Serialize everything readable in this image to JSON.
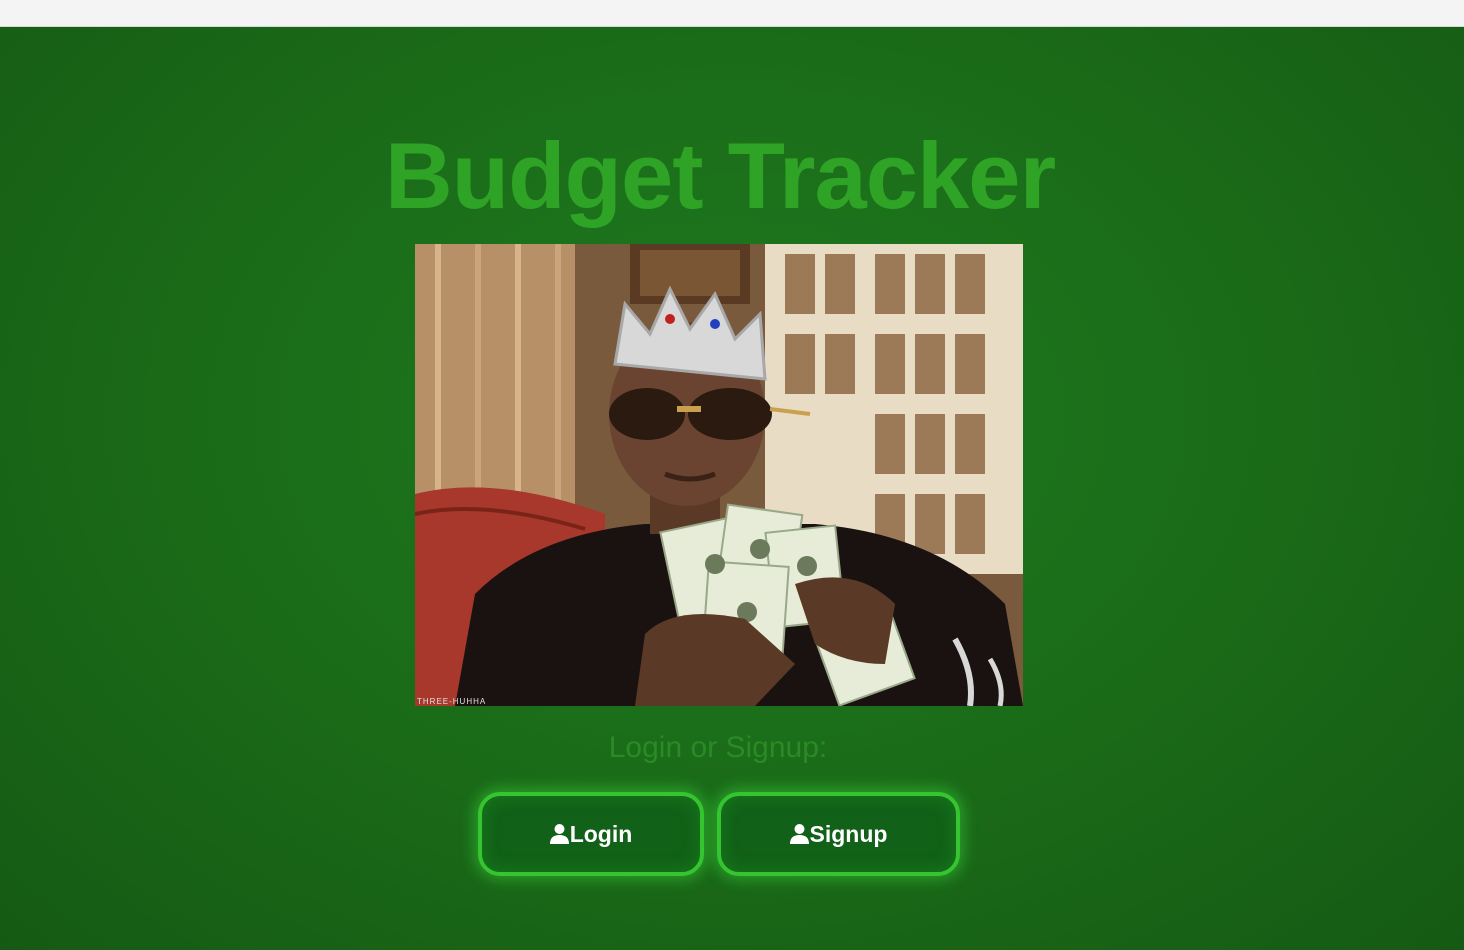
{
  "app": {
    "title": "Budget Tracker"
  },
  "hero_image": {
    "description_icon": "man-with-crown-holding-money-image",
    "watermark": "THREE-HUHHA"
  },
  "auth": {
    "prompt": "Login or Signup:",
    "login_label": "Login",
    "signup_label": "Signup",
    "icon": "user-icon"
  },
  "colors": {
    "background": "#1a6a18",
    "title": "#2ea326",
    "button_border": "#36c530",
    "button_fill": "#116118",
    "button_text": "#ffffff"
  }
}
